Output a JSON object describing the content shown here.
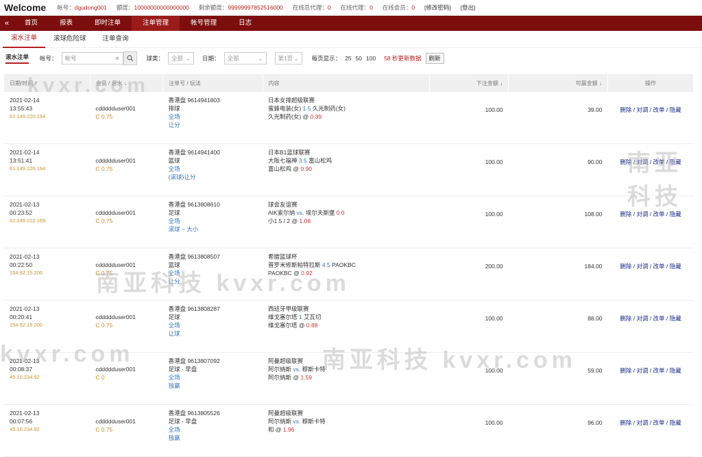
{
  "topbar": {
    "brand": "Welcome",
    "fields": [
      {
        "label": "帐号：",
        "value": "dgudong001"
      },
      {
        "label": "额度：",
        "value": "10000000000000000"
      },
      {
        "label": "剩余额度：",
        "value": "99999997852516000"
      },
      {
        "label": "在线总代理：",
        "value": "0"
      },
      {
        "label": "在线代理：",
        "value": "0"
      },
      {
        "label": "在线会员：",
        "value": "0"
      }
    ],
    "change_password": "[修改密码]",
    "logout": "[登出]"
  },
  "nav": {
    "collapse": "«",
    "items": [
      "首页",
      "报表",
      "即时注单",
      "注单管理",
      "帐号管理",
      "日志"
    ]
  },
  "subnav": {
    "items": [
      "滚水注单",
      "滚球危险球",
      "注单查询"
    ]
  },
  "filters": {
    "title": "滚水注单",
    "account_label": "帐号：",
    "account_placeholder": "帐号",
    "sport_label": "球类：",
    "sport_value": "全部",
    "date_label": "日期：",
    "date_value": "全部",
    "page_value": "第1页",
    "per_page_label": "每页显示：",
    "per_page_options": [
      "25",
      "50",
      "100"
    ],
    "refresh_note": "58 秒更新数据",
    "refresh_label": "刷新"
  },
  "table": {
    "headers": [
      "日期/时间 ↑",
      "会员 / 退水 ↓",
      "注单号 / 玩法",
      "内容",
      "下注金额 ↓",
      "可赢金额 ↓",
      "操作"
    ],
    "rows": [
      {
        "date": "2021-02-14",
        "time": "13:55:43",
        "ip": "61.149.220.194",
        "member": "cddddduser001",
        "rebate": "C 0.75",
        "bet_no": "香港盘 9614941803",
        "sport": "排球",
        "play1": "全场",
        "play2": "让分",
        "league": "日本女排超级联赛",
        "line1a": "蜜蜂电装(女)",
        "line1h": "1.5",
        "line1b": "久光制药(女)",
        "line2": "久光制药(女) @",
        "odds": "0.39",
        "amount": "100.00",
        "win": "39.00"
      },
      {
        "date": "2021-02-14",
        "time": "13:51:41",
        "ip": "61.149.220.194",
        "member": "cddddduser001",
        "rebate": "C 0.75",
        "bet_no": "香港盘 9614941400",
        "sport": "篮球",
        "play1": "全场",
        "play2": "(滚球)让分",
        "league": "日本B1篮球联赛",
        "line1a": "大阪七福神",
        "line1h": "3.5",
        "line1b": "富山松鸡",
        "line2": "富山松鸡 @",
        "odds": "0.90",
        "amount": "100.00",
        "win": "90.00"
      },
      {
        "date": "2021-02-13",
        "time": "00:23:52",
        "ip": "61.149.222.169",
        "member": "cddddduser001",
        "rebate": "C 0.75",
        "bet_no": "香港盘 9613808610",
        "sport": "足球",
        "play1": "全场",
        "play2": "滚球 ~ 大小",
        "league": "球会友谊赛",
        "line1a": "AIK索尔纳",
        "line1h": "vs.",
        "line1b": "埃尔夫斯堡",
        "line1r": "0:0",
        "line2": "小1.5 / 2 @",
        "odds": "1.08",
        "amount": "100.00",
        "win": "108.00"
      },
      {
        "date": "2021-02-13",
        "time": "00:22:50",
        "ip": "154.92.15.200",
        "member": "cddddduser001",
        "rebate": "C 0.75",
        "bet_no": "香港盘 9613808507",
        "sport": "篮球",
        "play1": "全场",
        "play2": "让分",
        "league": "希腊篮球杯",
        "line1a": "普罗米修斯帕特拉斯",
        "line1h": "4.5",
        "line1b": "PAOKBC",
        "line2": "PAOKBC @",
        "odds": "0.92",
        "amount": "200.00",
        "win": "184.00"
      },
      {
        "date": "2021-02-13",
        "time": "00:20:41",
        "ip": "154.92.15.200",
        "member": "cddddduser001",
        "rebate": "C 0.75",
        "bet_no": "香港盘 9613808287",
        "sport": "足球",
        "play1": "全场",
        "play2": "让球",
        "league": "西班牙甲级联赛",
        "line1a": "维戈塞尔塔",
        "line1h": "1",
        "line1b": "艾瓦切",
        "line2": "维戈塞尔塔 @",
        "odds": "0.88",
        "amount": "100.00",
        "win": "88.00"
      },
      {
        "date": "2021-02-13",
        "time": "00:08:37",
        "ip": "45.10.234.92",
        "member": "cddddduser001",
        "rebate": "C 0",
        "bet_no": "香港盘 9613807092",
        "sport": "足球 - 早盘",
        "play1": "全场",
        "play2": "独赢",
        "league": "阿曼超级联赛",
        "line1a": "阿尔纳斯",
        "line1h": "vs.",
        "line1b": "穆斯卡特",
        "line2": "阿尔纳斯 @",
        "odds": "1.59",
        "amount": "100.00",
        "win": "59.00"
      },
      {
        "date": "2021-02-13",
        "time": "00:07:56",
        "ip": "45.10.234.92",
        "member": "cddddduser001",
        "rebate": "C 0.75",
        "bet_no": "香港盘 9613805526",
        "sport": "足球 - 早盘",
        "play1": "全场",
        "play2": "独赢",
        "league": "阿曼超级联赛",
        "line1a": "阿尔纳斯",
        "line1h": "vs.",
        "line1b": "穆斯卡特",
        "line2": "和 @",
        "odds": "1.96",
        "amount": "100.00",
        "win": "96.00"
      }
    ],
    "ops": "删除 / 对调 / 改单 / 隐藏"
  },
  "watermarks": [
    "南亚科技",
    "kvxr.com",
    "南亚科技 kvxr.com",
    "kvxr.com",
    "南亚科技 kvxr.com"
  ]
}
